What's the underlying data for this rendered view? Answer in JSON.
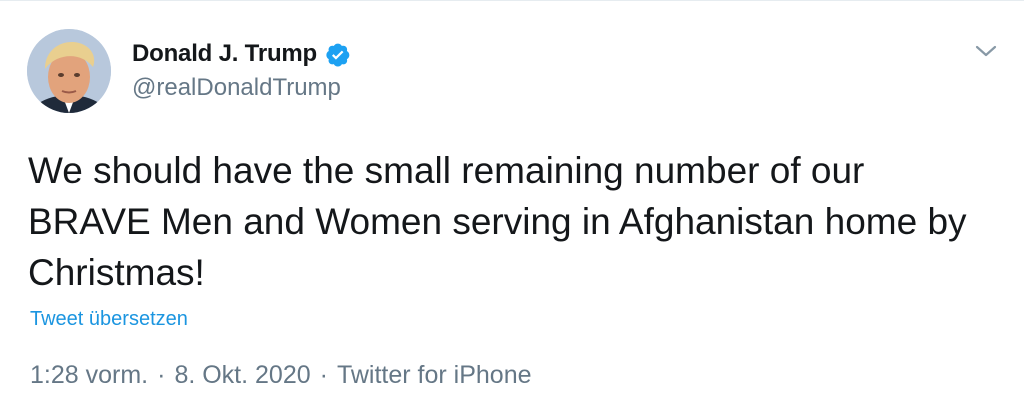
{
  "user": {
    "display_name": "Donald J. Trump",
    "handle": "@realDonaldTrump",
    "verified_icon": "verified-badge-icon",
    "avatar_icon": "profile-photo-avatar"
  },
  "menu": {
    "caret_icon": "chevron-down-icon"
  },
  "tweet": {
    "text": "We should have the small remaining number of our\nBRAVE Men and Women serving in Afghanistan home by\nChristmas!",
    "translate_label": "Tweet übersetzen"
  },
  "meta": {
    "time": "1:28 vorm.",
    "separator": "·",
    "date": "8. Okt. 2020",
    "source": "Twitter for iPhone"
  },
  "colors": {
    "accent_blue": "#1b95e0",
    "verified_blue": "#1da1f2",
    "secondary_text": "#657786",
    "primary_text": "#14171a"
  }
}
